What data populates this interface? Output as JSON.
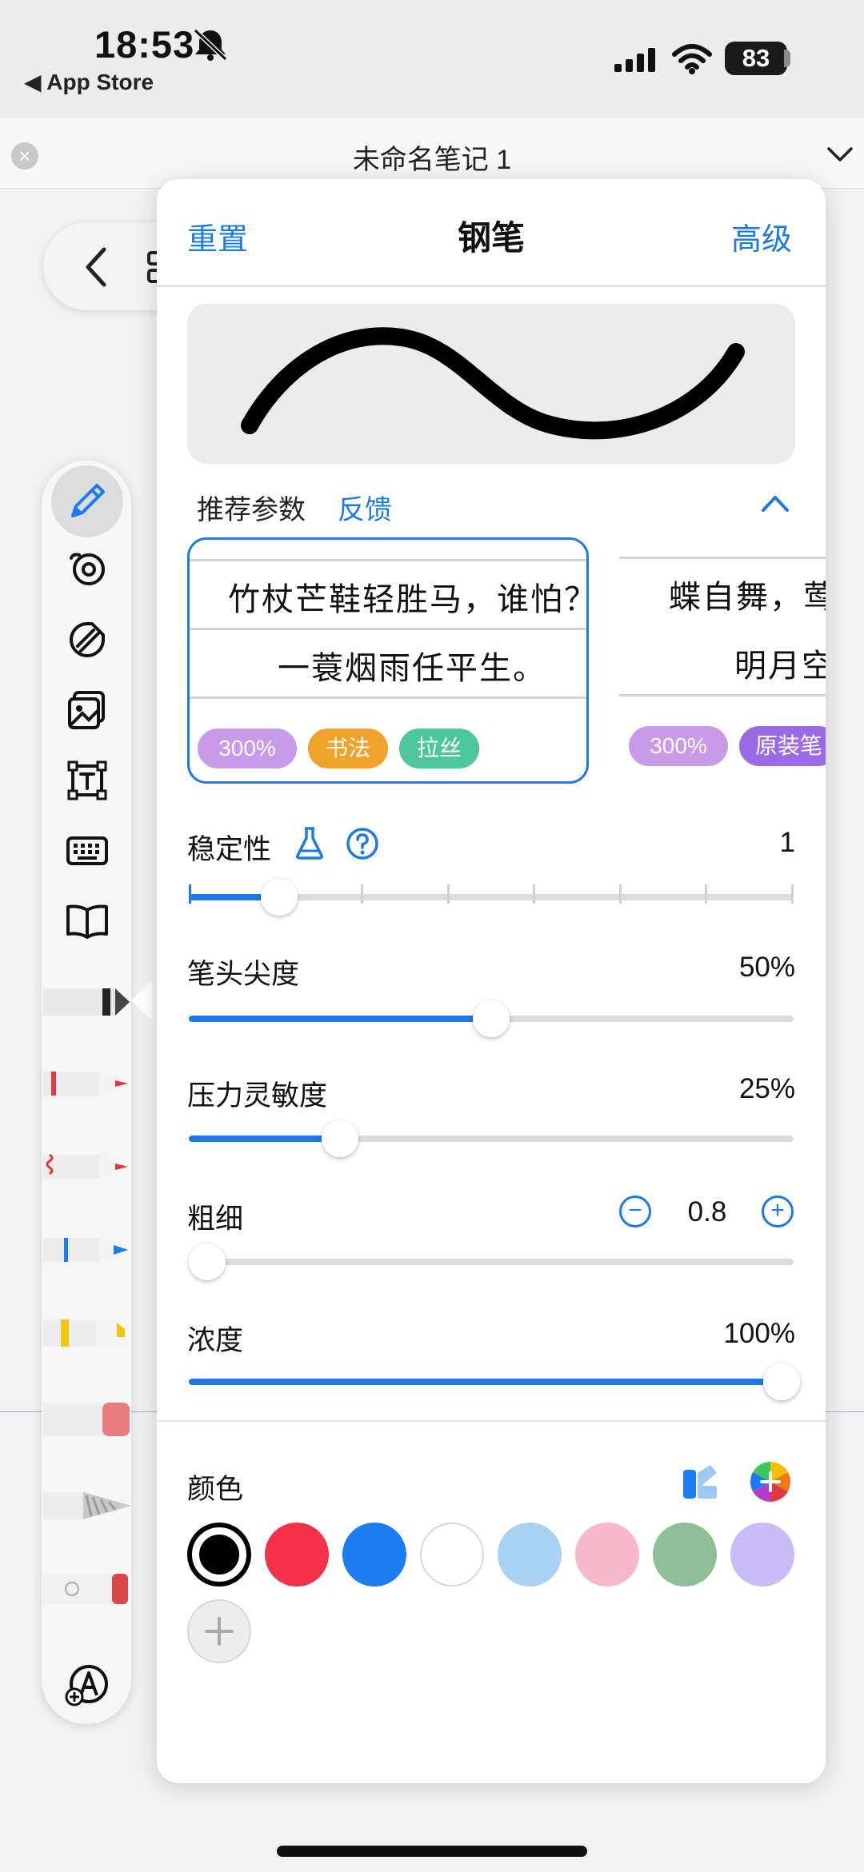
{
  "status_bar": {
    "time": "18:53",
    "back_app": "◀ App Store",
    "battery": "83"
  },
  "note": {
    "title": "未命名笔记 1",
    "close": "×"
  },
  "panel": {
    "reset": "重置",
    "title": "钢笔",
    "advanced": "高级"
  },
  "recommend": {
    "label": "推荐参数",
    "feedback": "反馈"
  },
  "presets": [
    {
      "line1": "竹杖芒鞋轻胜马，谁怕？",
      "line2": "一蓑烟雨任平生。",
      "tags": [
        {
          "text": "300%",
          "color": "#c79be8"
        },
        {
          "text": "书法",
          "color": "#f0a32a"
        },
        {
          "text": "拉丝",
          "color": "#4cc79b"
        }
      ]
    },
    {
      "line1": "蝶自舞，莺自语",
      "line2": "明月空庭",
      "tags": [
        {
          "text": "300%",
          "color": "#c79be8"
        },
        {
          "text": "原装笔",
          "color": "#9b6ae6"
        }
      ]
    }
  ],
  "settings": {
    "stability": {
      "label": "稳定性",
      "value": "1",
      "level": 0.15
    },
    "tip_sharpness": {
      "label": "笔头尖度",
      "value": "50%",
      "level": 0.5
    },
    "pressure": {
      "label": "压力灵敏度",
      "value": "25%",
      "level": 0.25
    },
    "thickness": {
      "label": "粗细",
      "value": "0.8",
      "minus": "−",
      "plus": "+",
      "level": 0.03
    },
    "opacity": {
      "label": "浓度",
      "value": "100%",
      "level": 1.0
    }
  },
  "colors": {
    "label": "颜色",
    "swatches": [
      "#000000",
      "#f5304a",
      "#1a7cf0",
      "#ffffff",
      "#a8d2f3",
      "#f8b8cc",
      "#8fbf98",
      "#c8bbf7"
    ],
    "selected": "#000000",
    "add": "+"
  },
  "toolbar_tools": [
    "pen-icon",
    "lasso-icon",
    "shape-icon",
    "image-icon",
    "textbox-icon",
    "keyboard-icon",
    "book-icon"
  ],
  "pens": [
    {
      "name": "black-pen",
      "color": "#222222"
    },
    {
      "name": "red-pen",
      "color": "#e0383e"
    },
    {
      "name": "red-wave-pen",
      "color": "#e0383e"
    },
    {
      "name": "blue-pen",
      "color": "#1a7cf0"
    },
    {
      "name": "yellow-highlighter",
      "color": "#f1c40f"
    },
    {
      "name": "pink-eraser",
      "color": "#e77c80"
    },
    {
      "name": "pencil",
      "color": "#9a9a9a"
    },
    {
      "name": "red-marker",
      "color": "#d84848"
    }
  ]
}
